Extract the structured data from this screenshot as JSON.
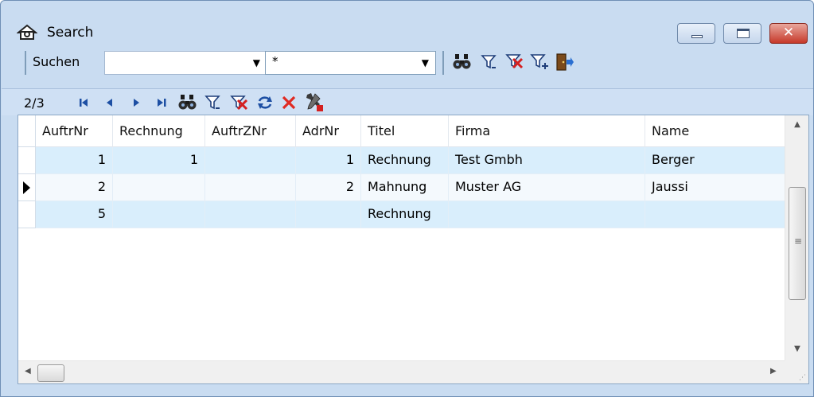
{
  "window": {
    "title": "Search",
    "controls": {
      "minimize_icon": "minimize-icon",
      "maximize_icon": "maximize-icon",
      "close_icon": "close-icon",
      "close_glyph": "✕"
    }
  },
  "toolbar": {
    "search_label": "Suchen",
    "field_select": {
      "value": "",
      "arrow": "▼"
    },
    "pattern_select": {
      "value": "*",
      "arrow": "▼"
    },
    "icons": [
      "binoculars-search-icon",
      "filter-icon",
      "filter-remove-icon",
      "filter-add-icon",
      "exit-door-icon"
    ]
  },
  "navigator": {
    "position": "2/3",
    "icons": [
      "first-record-icon",
      "previous-record-icon",
      "next-record-icon",
      "last-record-icon",
      "binoculars-search-icon",
      "filter-icon",
      "filter-remove-icon",
      "refresh-icon",
      "delete-icon",
      "tools-icon"
    ]
  },
  "grid": {
    "columns": [
      "AuftrNr",
      "Rechnung",
      "AuftrZNr",
      "AdrNr",
      "Titel",
      "Firma",
      "Name"
    ],
    "rows": [
      {
        "AuftrNr": "1",
        "Rechnung": "1",
        "AuftrZNr": "",
        "AdrNr": "1",
        "Titel": "Rechnung",
        "Firma": "Test Gmbh",
        "Name": "Berger"
      },
      {
        "AuftrNr": "2",
        "Rechnung": "",
        "AuftrZNr": "",
        "AdrNr": "2",
        "Titel": "Mahnung",
        "Firma": "Muster AG",
        "Name": "Jaussi"
      },
      {
        "AuftrNr": "5",
        "Rechnung": "",
        "AuftrZNr": "",
        "AdrNr": "",
        "Titel": "Rechnung",
        "Firma": "",
        "Name": ""
      }
    ],
    "current_row": 2
  },
  "colors": {
    "accent": "#cfe0f4",
    "row_alt": "#d9eefc",
    "close_red": "#c6392a"
  }
}
